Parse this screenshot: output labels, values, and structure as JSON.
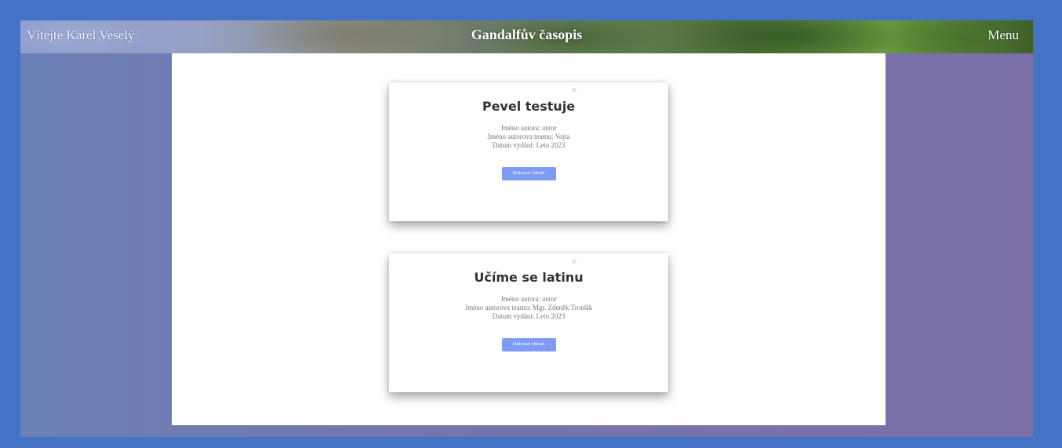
{
  "header": {
    "welcome": "Vítejte Karel Veselý",
    "title": "Gandalfův časopis",
    "menu_label": "Menu"
  },
  "articles": [
    {
      "title": "Pevel testuje",
      "author": "Jméno autora: autor",
      "team": "Jméno autorova teamu: Vojta",
      "date": "Datum vydání: Leto 2023",
      "button_label": "Stáhnout článek"
    },
    {
      "title": "Učíme se latinu",
      "author": "Jméno autora: autor",
      "team": "Jméno autorova teamu: Mgr. Zdeněk Tronšík",
      "date": "Datum vydání: Leto 2023",
      "button_label": "Stáhnout článek"
    }
  ],
  "colors": {
    "outer_border": "#4472c4",
    "background": "#7574ad",
    "button": "#7f9cf5",
    "content": "#ffffff"
  }
}
